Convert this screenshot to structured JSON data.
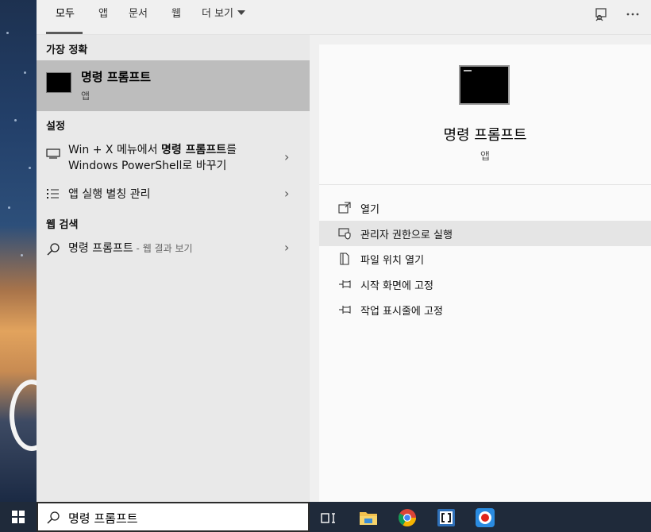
{
  "tabs": [
    {
      "label": "모두",
      "active": true
    },
    {
      "label": "앱"
    },
    {
      "label": "문서"
    },
    {
      "label": "웹"
    },
    {
      "label": "더 보기"
    }
  ],
  "top_icons": [
    "feedback-icon",
    "more-options-icon"
  ],
  "sections": {
    "best_match": "가장 정확",
    "settings": "설정",
    "web_search": "웹 검색"
  },
  "best_match": {
    "title": "명령 프롬프트",
    "type": "앱"
  },
  "settings_items": [
    {
      "line1_pre": "Win + X 메뉴에서 ",
      "line1_bold": "명령 프롬프트",
      "line1_post": "를",
      "line2": "Windows PowerShell로 바꾸기"
    },
    {
      "text": "앱 실행 별칭 관리"
    }
  ],
  "web_item": {
    "query": "명령 프롬프트",
    "suffix": " - 웹 결과 보기"
  },
  "preview": {
    "title": "명령 프롬프트",
    "type": "앱"
  },
  "actions": [
    {
      "label": "열기",
      "icon": "open-icon"
    },
    {
      "label": "관리자 권한으로 실행",
      "icon": "admin-shield-icon",
      "highlighted": true
    },
    {
      "label": "파일 위치 열기",
      "icon": "file-location-icon"
    },
    {
      "label": "시작 화면에 고정",
      "icon": "pin-icon"
    },
    {
      "label": "작업 표시줄에 고정",
      "icon": "pin-icon"
    }
  ],
  "search": {
    "value": "명령 프롬프트"
  },
  "taskbar": [
    "task-view-icon",
    "file-explorer-icon",
    "chrome-icon",
    "brackets-icon",
    "screen-recorder-icon"
  ],
  "colors": {
    "accent_bg": "#bdbdbd",
    "panel_bg": "#f0f0f0",
    "taskbar_bg": "#1f2a3a"
  }
}
